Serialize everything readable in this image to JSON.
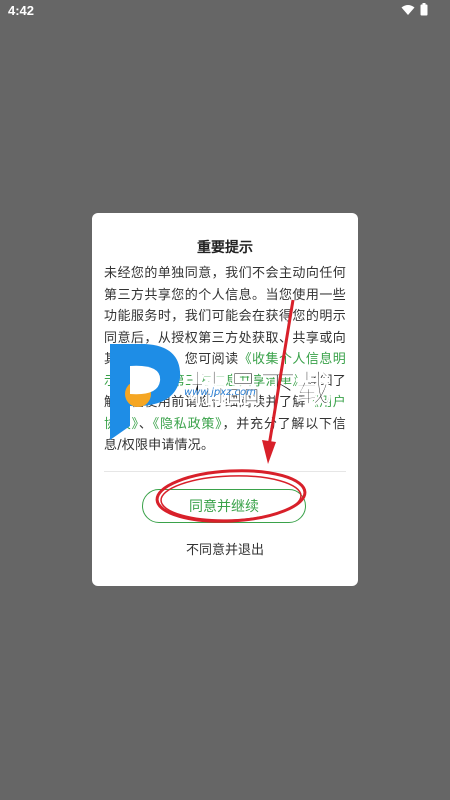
{
  "status_bar": {
    "time": "4:42",
    "icons": [
      "wifi-icon",
      "battery-icon"
    ]
  },
  "dialog": {
    "title": "重要提示",
    "body_parts": [
      {
        "text": "未经您的单独同意，我们不会主动向任何第三方共享您的个人信息。当您使用一些功能服务时，我们可能会在获得您的明示同意后，从授权第三方处获取、共享或向其提供信息。您可阅读",
        "link": false
      },
      {
        "text": "《收集个人信息明示清单》、《第三方信息共享清单》",
        "link": true
      },
      {
        "text": "详细了解。在使用前请您仔细阅读并了解",
        "link": false
      },
      {
        "text": "《用户协议》",
        "link": true
      },
      {
        "text": "、",
        "link": false
      },
      {
        "text": "《隐私政策》",
        "link": true
      },
      {
        "text": "，并充分了解以下信息/权限申请情况。",
        "link": false
      }
    ],
    "agree_label": "同意并继续",
    "disagree_label": "不同意并退出"
  },
  "watermark": {
    "brand": "精品下载",
    "url": "www.jpxz.com"
  },
  "colors": {
    "overlay": "#666666",
    "accent_green": "#3aa24a",
    "annotation_red": "#d8202a"
  }
}
